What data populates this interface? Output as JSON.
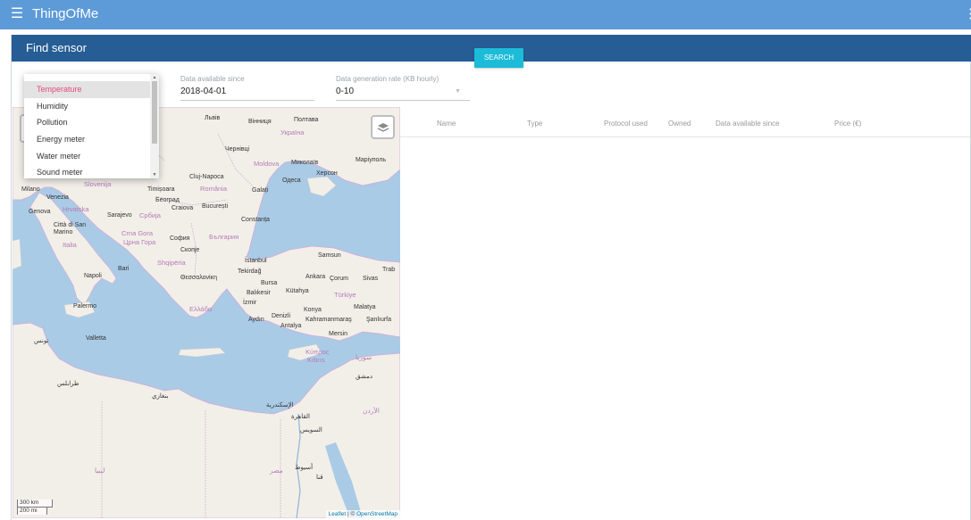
{
  "app": {
    "title": "ThingOfMe",
    "menu_icon": "menu-icon",
    "more_icon": "more-vert-icon"
  },
  "panel": {
    "title": "Find sensor"
  },
  "filters": {
    "since": {
      "label": "Data available since",
      "value": "2018-04-01"
    },
    "rate": {
      "label": "Data generation rate (KB hourly)",
      "value": "0-10"
    },
    "search_label": "SEARCH"
  },
  "sensor_types": {
    "options": [
      "Temperature",
      "Humidity",
      "Pollution",
      "Energy meter",
      "Water meter",
      "Sound meter"
    ],
    "selected": "Temperature"
  },
  "table": {
    "columns": [
      "Name",
      "Type",
      "Protocol used",
      "Owned",
      "Data available since",
      "Price (€)"
    ]
  },
  "map": {
    "attribution_leaflet": "Leaflet",
    "attribution_sep": " | © ",
    "attribution_osm": "OpenStreetMap",
    "scale_km": "300 km",
    "scale_mi": "200 mi",
    "labels": [
      "Львів",
      "Вінниця",
      "Полтава",
      "Україна",
      "Чернівці",
      "Moldova",
      "Миколаїв",
      "Маріуполь",
      "Херсон",
      "Одеса",
      "Cluj-Napoca",
      "România",
      "Timișoara",
      "Galați",
      "Београд",
      "Craiova",
      "București",
      "Constanța",
      "Sarajevo",
      "Србија",
      "Crna Gora",
      "Црна Гора",
      "София",
      "България",
      "Скопје",
      "Shqipëria",
      "İstanbul",
      "Samsun",
      "Trab",
      "Tekirdağ",
      "Bursa",
      "Ankara",
      "Çorum",
      "Sivas",
      "Θεσσαλονίκη",
      "Balıkesir",
      "Kütahya",
      "Türkiye",
      "İzmir",
      "Ελλάδα",
      "Konya",
      "Malatya",
      "Aydın",
      "Denizli",
      "Kahramanmaraş",
      "Şanlıurfa",
      "Antalya",
      "Mersin",
      "Κύπρος",
      "Kıbrıs",
      "Milano",
      "Venezia",
      "Genova",
      "Hrvatska",
      "Slovenija",
      "Città di San Marino",
      "Italia",
      "Bari",
      "Napoli",
      "Palermo",
      "Valletta",
      "الإسكندرية",
      "القاهرة",
      "السويس",
      "ليبيا",
      "مصر",
      "أسيوط",
      "قنا",
      "سوريا",
      "دمشق",
      "الأردن",
      "طرابلس",
      "تونس",
      "بنغازي"
    ]
  }
}
